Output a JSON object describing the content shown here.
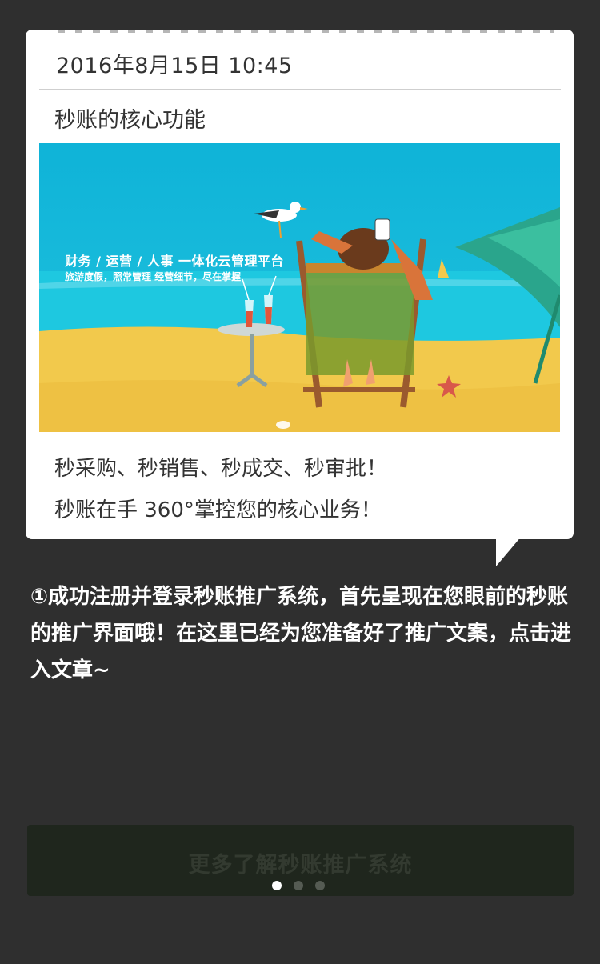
{
  "card": {
    "date": "2016年8月15日  10:45",
    "title": "秒账的核心功能",
    "banner": {
      "line1": "财务 / 运营 / 人事 一体化云管理平台",
      "line2": "旅游度假，照常管理 经营细节，尽在掌握"
    },
    "line1": "秒采购、秒销售、秒成交、秒审批！",
    "line2": "秒账在手 360°掌控您的核心业务！"
  },
  "description": "①成功注册并登录秒账推广系统，首先呈现在您眼前的秒账的推广界面哦！在这里已经为您准备好了推广文案，点击进入文章~",
  "cta": {
    "label": "更多了解秒账推广系统"
  },
  "pager": {
    "count": 3,
    "active_index": 0
  },
  "colors": {
    "background": "#2f2f2f",
    "card": "#ffffff",
    "cta_bg": "#1f261d",
    "sky": "#12b6d9",
    "sand": "#f2c94c"
  }
}
